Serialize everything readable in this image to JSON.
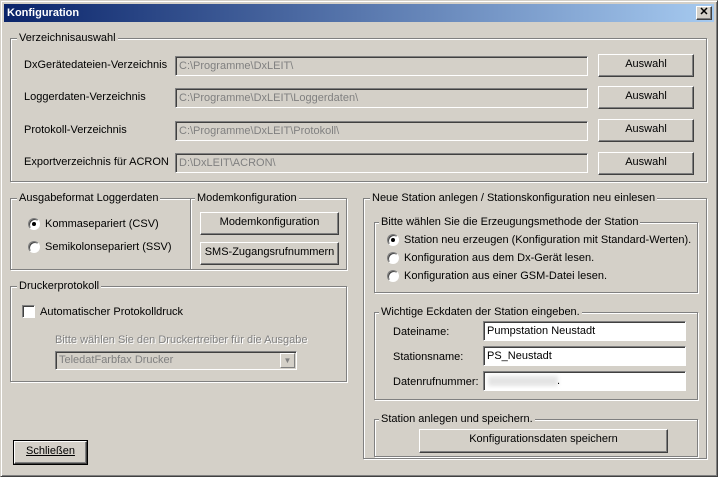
{
  "window": {
    "title": "Konfiguration",
    "close_glyph": "✕"
  },
  "directories": {
    "legend": "Verzeichnisauswahl",
    "rows": [
      {
        "label": "DxGerätedateien-Verzeichnis",
        "value": "C:\\Programme\\DxLEIT\\",
        "button": "Auswahl"
      },
      {
        "label": "Loggerdaten-Verzeichnis",
        "value": "C:\\Programme\\DxLEIT\\Loggerdaten\\",
        "button": "Auswahl"
      },
      {
        "label": "Protokoll-Verzeichnis",
        "value": "C:\\Programme\\DxLEIT\\Protokoll\\",
        "button": "Auswahl"
      },
      {
        "label": "Exportverzeichnis für ACRON",
        "value": "D:\\DxLEIT\\ACRON\\",
        "button": "Auswahl"
      }
    ]
  },
  "logger_format": {
    "legend": "Ausgabeformat Loggerdaten",
    "options": [
      {
        "label": "Kommasepariert (CSV)",
        "selected": true
      },
      {
        "label": "Semikolonsepariert (SSV)",
        "selected": false
      }
    ]
  },
  "modem": {
    "legend": "Modemkonfiguration",
    "button_config": "Modemkonfiguration",
    "button_sms": "SMS-Zugangsrufnummern"
  },
  "printer": {
    "legend": "Druckerprotokoll",
    "auto_print_label": "Automatischer Protokolldruck",
    "auto_print_checked": false,
    "driver_prompt": "Bitte wählen Sie den Druckertreiber für die Ausgabe",
    "driver_value": "TeledatFarbfax Drucker"
  },
  "new_station": {
    "legend": "Neue Station anlegen / Stationskonfiguration neu einlesen",
    "method": {
      "legend": "Bitte wählen Sie die Erzeugungsmethode der Station",
      "options": [
        {
          "label": "Station neu erzeugen (Konfiguration mit Standard-Werten).",
          "selected": true
        },
        {
          "label": "Konfiguration aus dem Dx-Gerät lesen.",
          "selected": false
        },
        {
          "label": "Konfiguration aus einer GSM-Datei lesen.",
          "selected": false
        }
      ]
    },
    "details": {
      "legend": "Wichtige Eckdaten der Station eingeben.",
      "filename_label": "Dateiname:",
      "filename_value": "Pumpstation Neustadt",
      "stationname_label": "Stationsname:",
      "stationname_value": "PS_Neustadt",
      "dialnumber_label": "Datenrufnummer:",
      "dialnumber_value": "."
    },
    "save": {
      "legend": "Station anlegen und speichern.",
      "button": "Konfigurationsdaten speichern"
    }
  },
  "footer": {
    "close_button": "Schließen"
  }
}
